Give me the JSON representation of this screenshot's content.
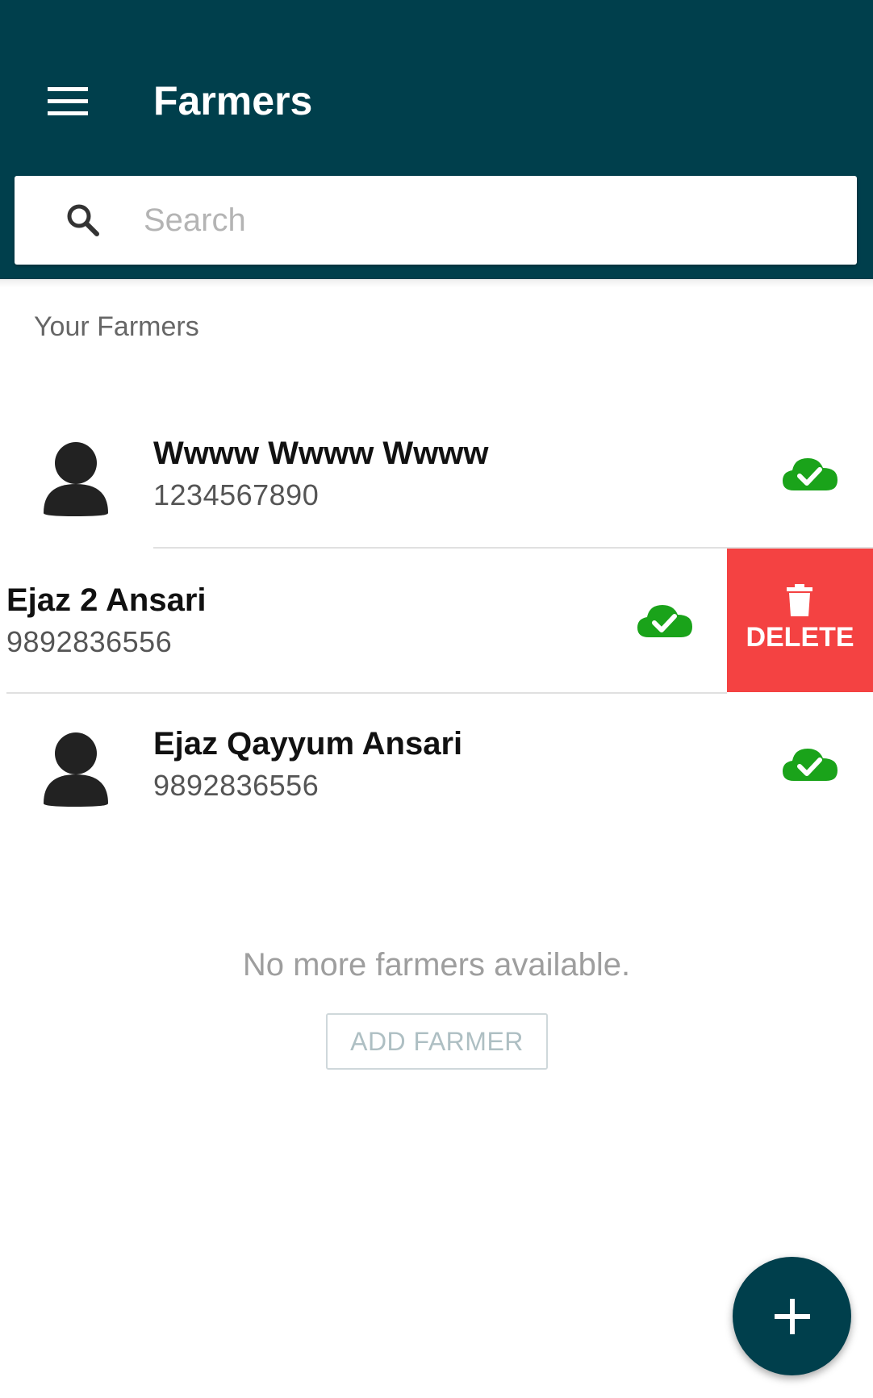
{
  "colors": {
    "header_bg": "#003f4c",
    "delete_bg": "#f44242",
    "sync_icon_color": "#1aa31a",
    "fab_bg": "#003f4c"
  },
  "header": {
    "title": "Farmers",
    "menu_icon": "hamburger-menu-icon"
  },
  "search": {
    "placeholder": "Search",
    "icon": "search-icon"
  },
  "section": {
    "title": "Your Farmers"
  },
  "farmers": [
    {
      "name": "Wwww Wwww Wwww",
      "phone": "1234567890",
      "status_icon": "cloud-check-icon",
      "avatar_icon": "person-icon"
    },
    {
      "name": "Ejaz 2 Ansari",
      "phone": "9892836556",
      "status_icon": "cloud-check-icon",
      "swiped": true
    },
    {
      "name": "Ejaz Qayyum Ansari",
      "phone": "9892836556",
      "status_icon": "cloud-check-icon",
      "avatar_icon": "person-icon"
    }
  ],
  "swipe_action": {
    "label": "DELETE",
    "icon": "trash-icon"
  },
  "empty_state": {
    "message": "No more farmers available.",
    "button_label": "ADD FARMER"
  },
  "fab": {
    "icon": "plus-icon"
  }
}
